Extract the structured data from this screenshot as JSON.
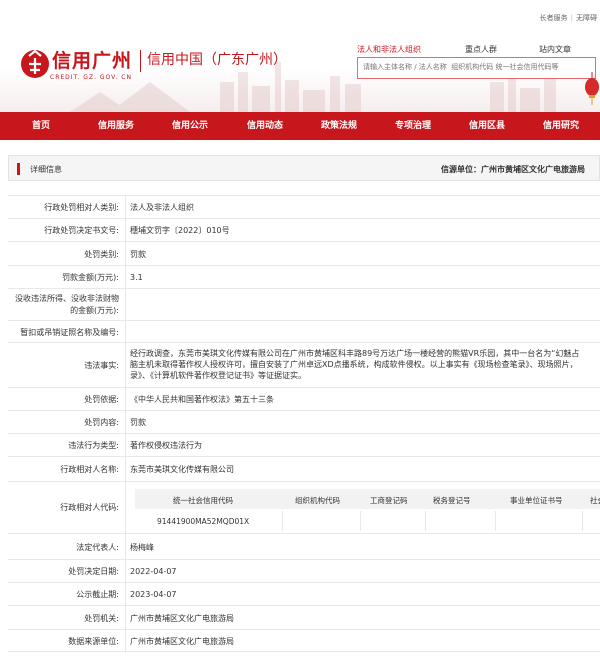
{
  "top_links": [
    "长者服务",
    "无障碍"
  ],
  "logo": {
    "text": "信用广州",
    "sub": "CREDIT. GZ. GOV. CN",
    "right": "信用中国（广东广州）"
  },
  "search": {
    "tabs": [
      "法人和非法人组织",
      "重点人群",
      "站内文章"
    ],
    "active_tab": 0,
    "placeholder": "请输入主体名称 / 法人名称  组织机构代码 统一社会信用代码等"
  },
  "nav": [
    "首页",
    "信用服务",
    "信用公示",
    "信用动态",
    "政策法规",
    "专项治理",
    "信用区县",
    "信用研究"
  ],
  "panel": {
    "title": "详细信息",
    "source": "信源单位：广州市黄埔区文化广电旅游局"
  },
  "rows": [
    {
      "label": "行政处罚相对人类别:",
      "value": "法人及非法人组织"
    },
    {
      "label": "行政处罚决定书文号:",
      "value": "穗埔文罚字〔2022〕010号"
    },
    {
      "label": "处罚类别:",
      "value": "罚款"
    },
    {
      "label": "罚款金额(万元):",
      "value": "3.1"
    },
    {
      "label": "没收违法所得、没收非法财物的金额(万元):",
      "value": ""
    },
    {
      "label": "暂扣或吊销证照名称及编号:",
      "value": ""
    },
    {
      "label": "违法事实:",
      "lines": [
        "经行政调查，东莞市美琪文化传媒有限公司在广州市黄埔区科丰路89号万达广场一楼经营的熊猫VR乐园，其中一台名为“幻魅占",
        "脑主机未取得著作权人授权许可，擅自安装了广州卓远XD点播系统，构成软件侵权。以上事实有《现场检查笔录》、现场照片，",
        "录》、《计算机软件著作权登记证书》等证据证实。"
      ]
    },
    {
      "label": "处罚依据:",
      "value": "《中华人民共和国著作权法》第五十三条"
    },
    {
      "label": "处罚内容:",
      "value": "罚款"
    },
    {
      "label": "违法行为类型:",
      "value": "著作权侵权违法行为"
    },
    {
      "label": "行政相对人名称:",
      "value": "东莞市美琪文化传媒有限公司"
    },
    {
      "label": "行政相对人代码:",
      "codes": {
        "headers": [
          "统一社会信用代码",
          "组织机构代码",
          "工商登记码",
          "税务登记号",
          "事业单位证书号",
          "社会"
        ],
        "values": [
          "91441900MA52MQD01X",
          "",
          "",
          "",
          "",
          ""
        ]
      }
    },
    {
      "label": "法定代表人:",
      "value": "杨梅峰"
    },
    {
      "label": "处罚决定日期:",
      "value": "2022-04-07"
    },
    {
      "label": "公示截止期:",
      "value": "2023-04-07"
    },
    {
      "label": "处罚机关:",
      "value": "广州市黄埔区文化广电旅游局"
    },
    {
      "label": "数据来源单位:",
      "value": "广州市黄埔区文化广电旅游局"
    }
  ],
  "colors": {
    "brand": "#c8161d",
    "panel_bg": "#f5f5f5",
    "border": "#e8e8e8"
  }
}
